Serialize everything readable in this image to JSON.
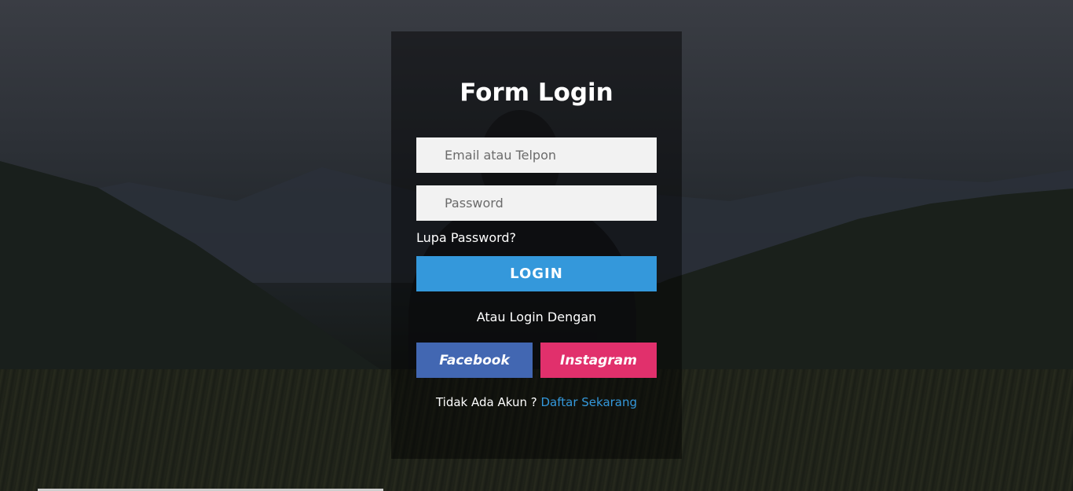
{
  "form": {
    "title": "Form Login",
    "email_placeholder": "Email atau Telpon",
    "password_placeholder": "Password",
    "forgot_password": "Lupa Password?",
    "login_button": "LOGIN",
    "alt_login_text": "Atau Login Dengan",
    "facebook_button": "Facebook",
    "instagram_button": "Instagram",
    "no_account_text": "Tidak Ada Akun ?",
    "signup_link": "Daftar Sekarang"
  },
  "colors": {
    "login_button": "#3498db",
    "facebook": "#4267b2",
    "instagram": "#e1306c",
    "link": "#3498db"
  }
}
